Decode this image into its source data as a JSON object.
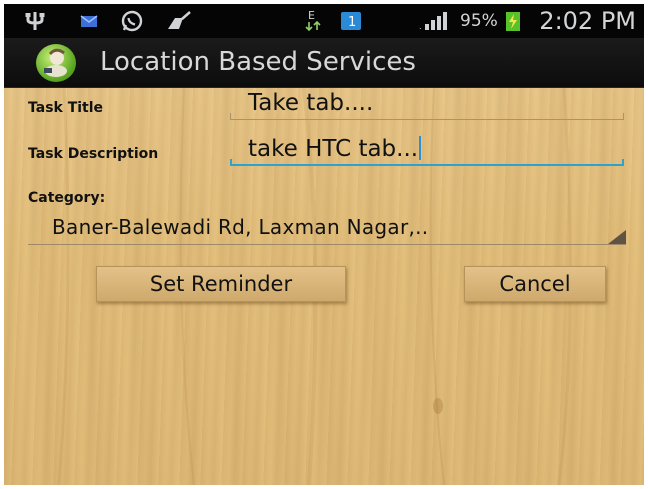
{
  "status_bar": {
    "icons": [
      "usb-icon",
      "message-icon",
      "whatsapp-icon",
      "cleaner-icon",
      "data-transfer-icon",
      "sim-icon",
      "signal-icon",
      "battery-charging-icon"
    ],
    "battery_percent": "95%",
    "time": "2:02 PM"
  },
  "action_bar": {
    "title": "Location Based Services",
    "icon": "app-icon"
  },
  "form": {
    "task_title_label": "Task Title",
    "task_title_value": "Take tab....",
    "task_description_label": "Task Description",
    "task_description_value": "take HTC tab...",
    "category_label": "Category:",
    "category_value": "Baner-Balewadi Rd, Laxman Nagar,.."
  },
  "buttons": {
    "set_reminder": "Set Reminder",
    "cancel": "Cancel"
  },
  "colors": {
    "status_bar": "#050505",
    "action_bar": "#141414",
    "wood": "#e4c07d",
    "focus_accent": "#2ea2cf"
  }
}
